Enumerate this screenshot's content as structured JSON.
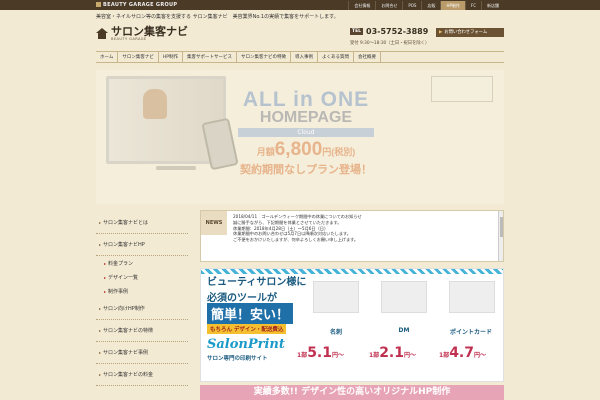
{
  "topbar": {
    "group_name": "BEAUTY GARAGE GROUP",
    "nav": [
      "会社情報",
      "お問合せ",
      "POS",
      "店販",
      "HP制作",
      "FC",
      "新店舗"
    ]
  },
  "tagline": "美容室・ネイルサロン等の集客を支援する サロン集客ナビ　美容業界No.1の実績で集客をサポートします。",
  "logo": {
    "name": "サロン集客ナビ",
    "sub": "BEAUTY GARAGE"
  },
  "contact": {
    "tel_label": "TEL",
    "tel": "03-5752-3889",
    "button": "お問い合わせフォーム",
    "hours": "受付 9:30〜18:30（土日・祝日を除く）"
  },
  "gnav": [
    "ホーム",
    "サロン集客ナビ",
    "HP制作",
    "集客サポートサービス",
    "サロン集客ナビの特徴",
    "導入事例",
    "よくある質問",
    "会社概要"
  ],
  "hero": {
    "line1": "ALL in ONE",
    "line2": "HOMEPAGE",
    "cloud": "Cloud",
    "price_label": "月額",
    "price": "6,800",
    "price_unit": "円(税別)",
    "plan": "契約期間なしプラン登場！"
  },
  "sidebar": {
    "items": [
      "サロン集客ナビとは",
      "サロン集客ナビHP",
      "サロン向けHP制作",
      "サロン集客ナビの特徴",
      "サロン集客ナビ事例",
      "サロン集客ナビの料金"
    ],
    "subitems": [
      "料金プラン",
      "デザイン一覧",
      "制作事例"
    ]
  },
  "news": {
    "label": "NEWS",
    "date": "2018/04/11",
    "headline": "ゴールデンウィーク期間中の休業についてのお知らせ",
    "lines": [
      "誠に勝手ながら、下記期間を休業とさせていただきます。",
      "休業期間：2018年4月28日（土）〜5月6日（日）",
      "休業期間中のお問い合わせは5月7日以降順次対応いたします。",
      "ご不便をおかけいたしますが、何卒よろしくお願い申し上げます。"
    ]
  },
  "banner": {
    "line1": "ビューティサロン様に",
    "line2": "必須のツールが",
    "line3": "簡単！安い！",
    "line4": "もちろん デザイン・配送費込",
    "brand": "SalonPrint",
    "brand_sub": "サロン専門の印刷サイト",
    "products": [
      {
        "label": "名刺",
        "prefix": "1部",
        "price": "5.1",
        "suffix": "円〜"
      },
      {
        "label": "DM",
        "prefix": "1部",
        "price": "2.1",
        "suffix": "円〜"
      },
      {
        "label": "ポイントカード",
        "prefix": "1部",
        "price": "4.7",
        "suffix": "円〜"
      }
    ]
  },
  "bottom_banner": "実績多数!! デザイン性の高いオリジナルHP制作",
  "colors": {
    "bg": "#f3ead3",
    "topbar": "#4a3a26",
    "accent_brown": "#6b5232",
    "pink": "#e7a4b6",
    "blue": "#1a5a80"
  }
}
